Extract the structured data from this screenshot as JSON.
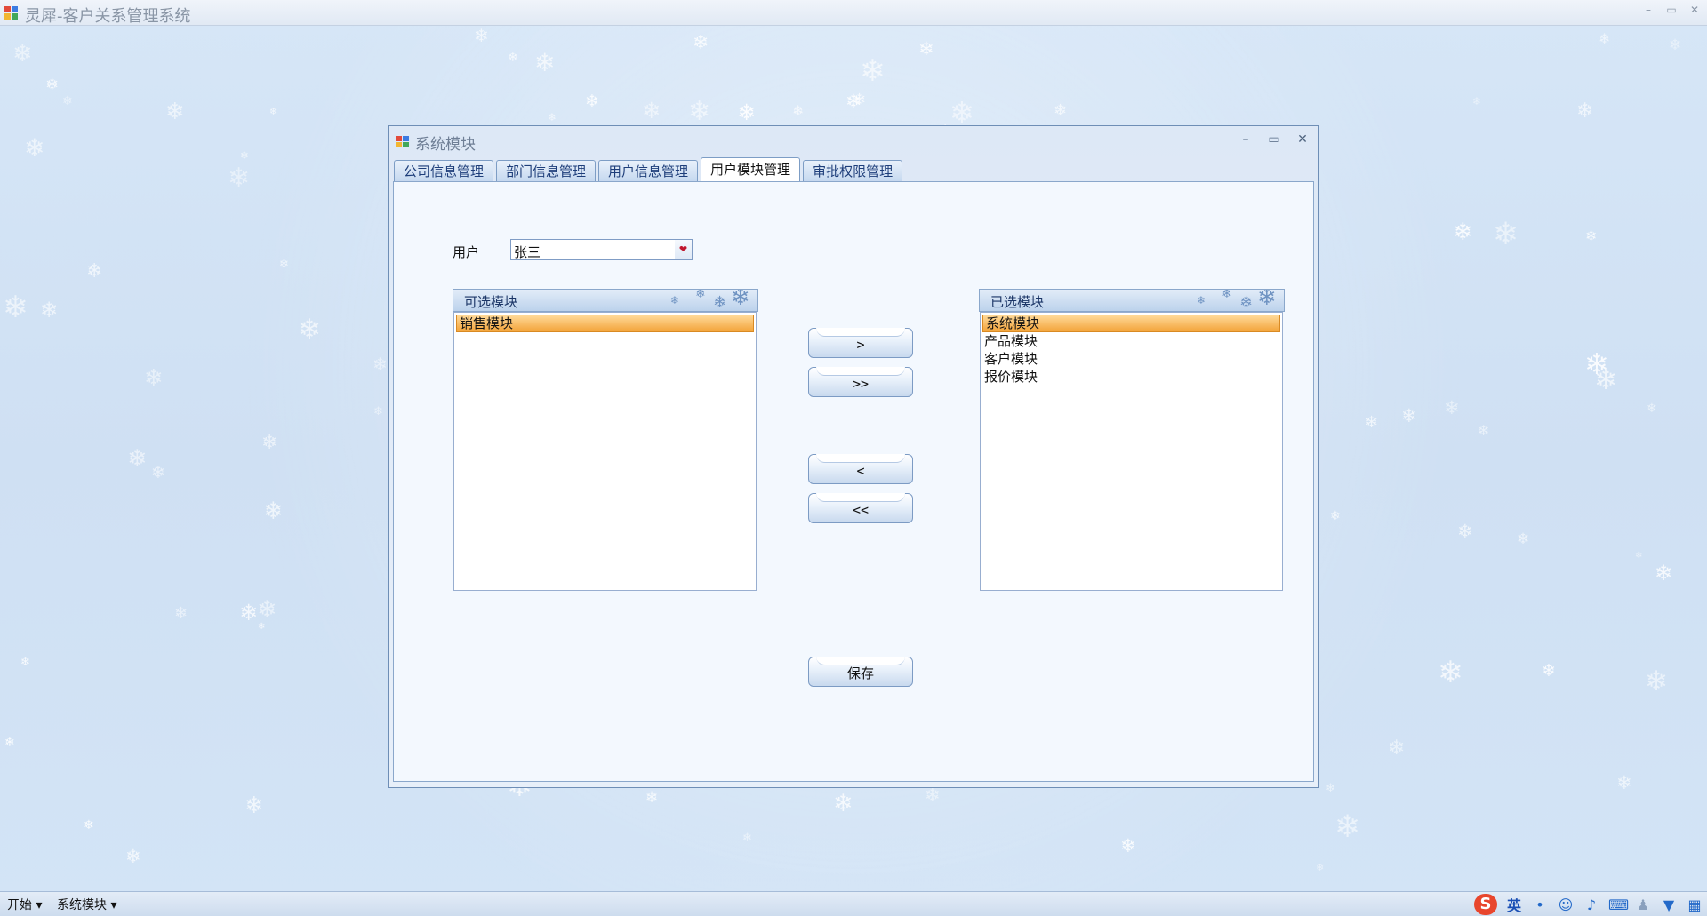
{
  "app": {
    "title": "灵犀-客户关系管理系统"
  },
  "dialog": {
    "title": "系统模块",
    "tabs": [
      {
        "label": "公司信息管理",
        "active": false
      },
      {
        "label": "部门信息管理",
        "active": false
      },
      {
        "label": "用户信息管理",
        "active": false
      },
      {
        "label": "用户模块管理",
        "active": true
      },
      {
        "label": "审批权限管理",
        "active": false
      }
    ]
  },
  "form": {
    "user_label": "用户",
    "user_value": "张三"
  },
  "available": {
    "header": "可选模块",
    "items": [
      "销售模块"
    ],
    "selected_index": 0
  },
  "chosen": {
    "header": "已选模块",
    "items": [
      "系统模块",
      "产品模块",
      "客户模块",
      "报价模块"
    ],
    "selected_index": 0
  },
  "buttons": {
    "add_one": ">",
    "add_all": ">>",
    "remove_one": "<",
    "remove_all": "<<",
    "save": "保存"
  },
  "taskbar": {
    "start": "开始",
    "window": "系统模块",
    "ime_lang": "英"
  },
  "colors": {
    "selection": "#f3a43a",
    "accent": "#7c9bc4"
  }
}
